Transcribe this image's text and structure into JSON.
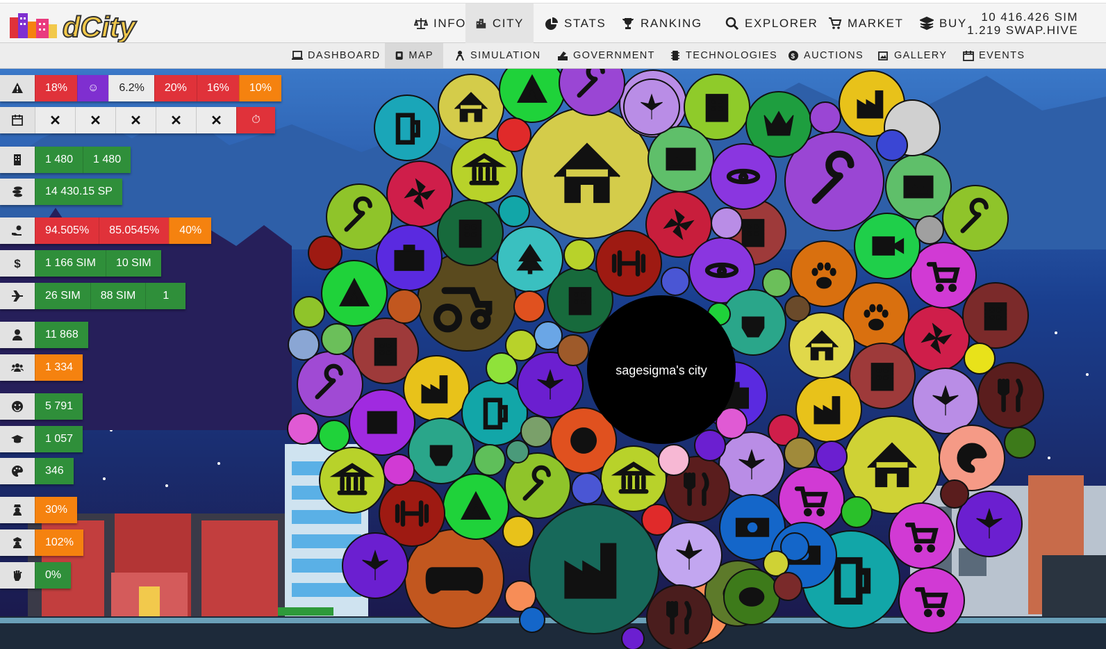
{
  "header": {
    "logo_text": "dCity",
    "nav": [
      {
        "label": "INFO",
        "icon": "scale-icon",
        "active": false
      },
      {
        "label": "CITY",
        "icon": "city-icon",
        "active": true
      },
      {
        "label": "STATS",
        "icon": "pie-chart-icon",
        "active": false
      },
      {
        "label": "RANKING",
        "icon": "trophy-icon",
        "active": false
      },
      {
        "label": "EXPLORER",
        "icon": "search-icon",
        "active": false
      },
      {
        "label": "MARKET",
        "icon": "cart-icon",
        "active": false
      },
      {
        "label": "BUY",
        "icon": "layers-icon",
        "active": false
      }
    ],
    "balance_sim": "10 416.426 SIM",
    "balance_swap": "1.219 SWAP.HIVE"
  },
  "subnav": [
    {
      "label": "DASHBOARD",
      "icon": "laptop-icon",
      "active": false
    },
    {
      "label": "MAP",
      "icon": "map-icon",
      "active": true
    },
    {
      "label": "SIMULATION",
      "icon": "simulation-icon",
      "active": false
    },
    {
      "label": "GOVERNMENT",
      "icon": "vote-icon",
      "active": false
    },
    {
      "label": "TECHNOLOGIES",
      "icon": "chip-icon",
      "active": false
    },
    {
      "label": "AUCTIONS",
      "icon": "coin-icon",
      "active": false
    },
    {
      "label": "GALLERY",
      "icon": "images-icon",
      "active": false
    },
    {
      "label": "EVENTS",
      "icon": "calendar-icon",
      "active": false
    }
  ],
  "stats": {
    "warnings": [
      "18%",
      "☺",
      "6.2%",
      "20%",
      "16%",
      "10%"
    ],
    "events": [
      "✕",
      "✕",
      "✕",
      "✕",
      "✕",
      "⏱"
    ],
    "buildings": [
      "1 480",
      "1 480"
    ],
    "sp": [
      "14 430.15 SP"
    ],
    "tax": [
      "94.505%",
      "85.0545%",
      "40%"
    ],
    "income": [
      "1 166 SIM",
      "10 SIM"
    ],
    "tourism": [
      "26 SIM",
      "88 SIM",
      "1"
    ],
    "population": "11 868",
    "unemployed": "1 334",
    "happy": "5 791",
    "education": "1 057",
    "creativity": "346",
    "crime": "30%",
    "police": "102%",
    "protest": "0%"
  },
  "city": {
    "name": "sagesigma's city"
  },
  "colors": {
    "header_bg": "#f4f4f4",
    "green": "#2f8f3a",
    "red": "#e0323a",
    "orange": "#f5820f",
    "purple": "#7f2fd0",
    "sky": "#1a3f8f"
  }
}
